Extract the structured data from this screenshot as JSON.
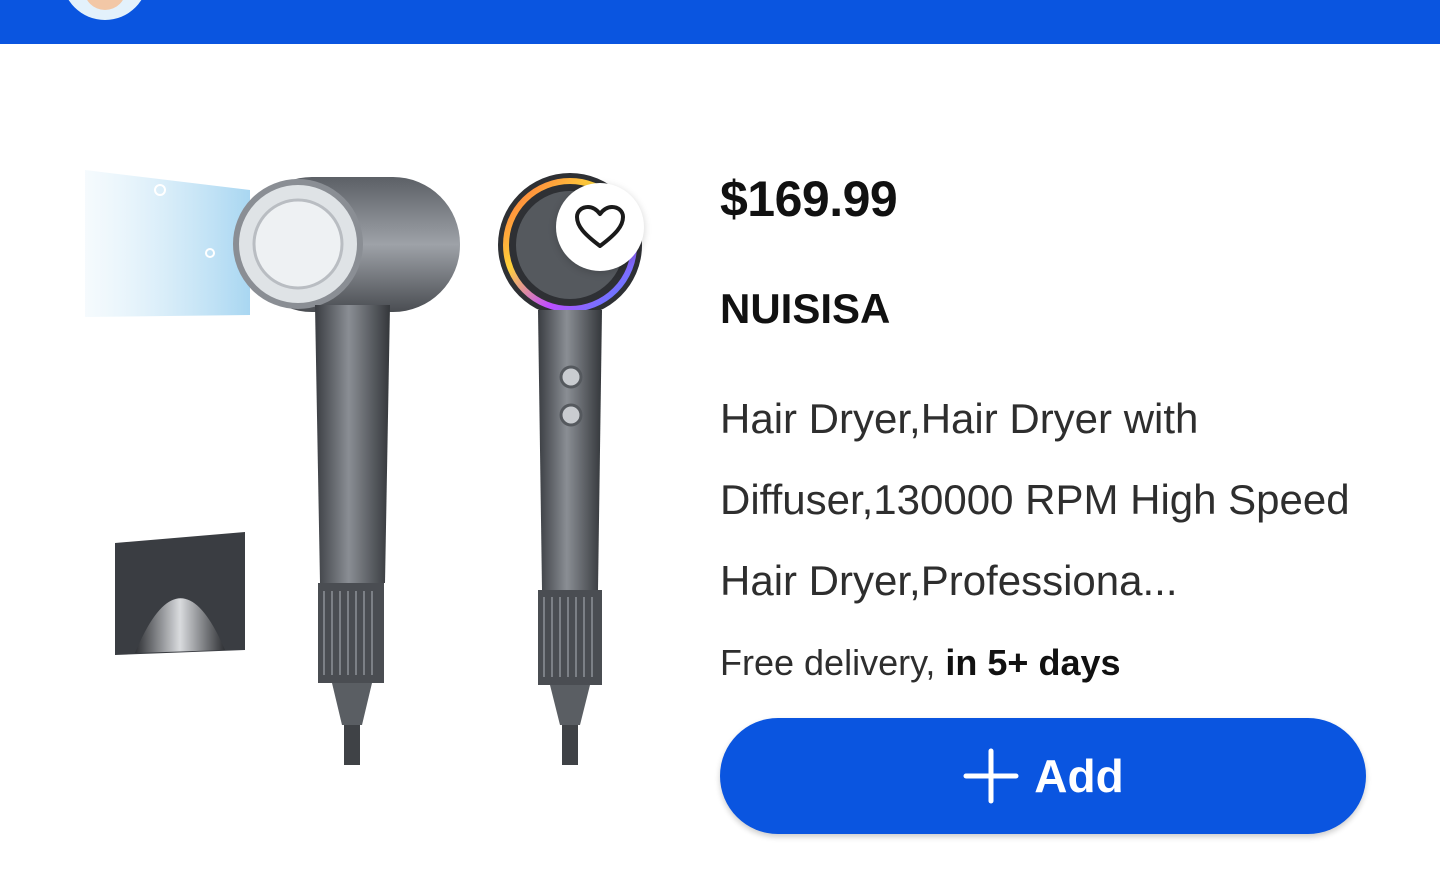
{
  "header": {
    "avatar_icon": "avatar-icon",
    "bar_color": "#0a55e0"
  },
  "product": {
    "image_alt": "hair-dryer-product-image",
    "favorite_icon": "heart-outline-icon",
    "price": "$169.99",
    "brand": "NUISISA",
    "title": "Hair Dryer,Hair Dryer with Diffuser,130000 RPM High Speed Hair Dryer,Professiona...",
    "delivery_prefix": "Free delivery, ",
    "delivery_eta": "in 5+ days",
    "add_label": "Add",
    "add_icon": "plus-icon",
    "accent_color": "#0a55e0"
  }
}
